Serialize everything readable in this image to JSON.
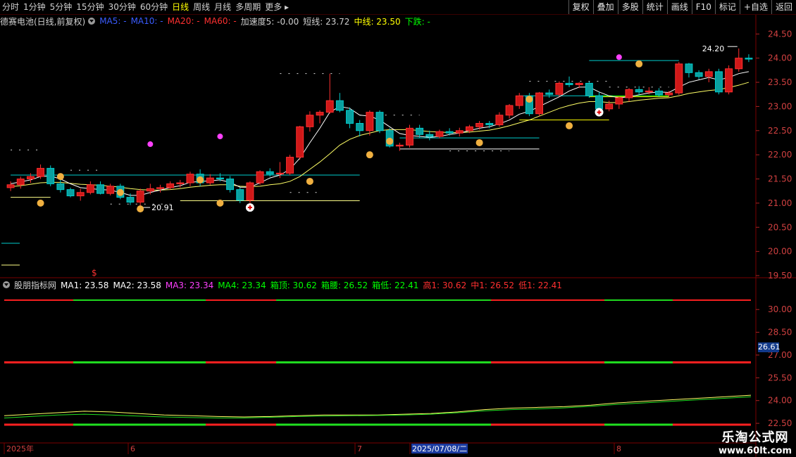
{
  "toolbar": {
    "periods": [
      "分时",
      "1分钟",
      "5分钟",
      "15分钟",
      "30分钟",
      "60分钟",
      "日线",
      "周线",
      "月线",
      "多周期",
      "更多"
    ],
    "active_period": "日线",
    "right_buttons": [
      "复权",
      "叠加",
      "多股",
      "统计",
      "画线",
      "F10",
      "标记",
      "+自选",
      "返回"
    ]
  },
  "main_legend": {
    "stock": "德赛电池(日线,前复权)",
    "ma5": "MA5: -",
    "ma10": "MA10: -",
    "ma20": "MA20: -",
    "ma60": "MA60: -",
    "accel": "加速度5: -0.00",
    "short": "短线: 23.72",
    "mid": "中线: 23.50",
    "down": "下跌: -",
    "colors": {
      "ma5": "#3a5cff",
      "ma10": "#3a5cff",
      "ma20": "#ff3030",
      "ma60": "#ff3030",
      "accel": "#d0d0d0",
      "short": "#d0d0d0",
      "mid": "#ffff00",
      "down": "#00ff00"
    }
  },
  "indicator_legend": {
    "name": "股朋指标网",
    "items": [
      {
        "text": "MA1: 23.58",
        "color": "#ffffff"
      },
      {
        "text": "MA2: 23.58",
        "color": "#ffffff"
      },
      {
        "text": "MA3: 23.34",
        "color": "#ff40ff"
      },
      {
        "text": "MA4: 23.34",
        "color": "#00ff00"
      },
      {
        "text": "箱顶: 30.62",
        "color": "#00ff00"
      },
      {
        "text": "箱腰: 26.52",
        "color": "#00ff00"
      },
      {
        "text": "箱低: 22.41",
        "color": "#00ff00"
      },
      {
        "text": "高1: 30.62",
        "color": "#ff3030"
      },
      {
        "text": "中1: 26.52",
        "color": "#ff3030"
      },
      {
        "text": "低1: 22.41",
        "color": "#ff3030"
      }
    ]
  },
  "main_axis": [
    "24.50",
    "24.00",
    "23.50",
    "23.00",
    "22.50",
    "22.00",
    "21.50",
    "21.00",
    "20.50",
    "20.00",
    "19.50"
  ],
  "ind_axis": [
    "30.00",
    "28.50",
    "27.00",
    "25.50",
    "24.00",
    "22.50"
  ],
  "indicator_current": "26.61",
  "date_axis": [
    {
      "label": "2025年",
      "highlight": false
    },
    {
      "label": "6",
      "highlight": false
    },
    {
      "label": "7",
      "highlight": false
    },
    {
      "label": "2025/07/08/二",
      "highlight": true
    },
    {
      "label": "8",
      "highlight": false
    }
  ],
  "annotations": {
    "high": "24.20",
    "low": "20.91"
  },
  "watermark": {
    "name": "乐淘公式网",
    "url": "www.60lt.com"
  },
  "colors": {
    "up": "#ff3030",
    "down": "#00cccc",
    "bg": "#000000",
    "grid": "#5a0000"
  },
  "chart_data": {
    "type": "candlestick",
    "ylim": [
      19.5,
      24.65
    ],
    "candles": [
      [
        21.32,
        21.45,
        21.25,
        21.38
      ],
      [
        21.38,
        21.55,
        21.3,
        21.5
      ],
      [
        21.5,
        21.62,
        21.42,
        21.55
      ],
      [
        21.55,
        21.8,
        21.5,
        21.72
      ],
      [
        21.72,
        21.78,
        21.35,
        21.4
      ],
      [
        21.4,
        21.5,
        21.22,
        21.28
      ],
      [
        21.28,
        21.32,
        21.12,
        21.15
      ],
      [
        21.15,
        21.3,
        21.05,
        21.22
      ],
      [
        21.22,
        21.45,
        21.18,
        21.38
      ],
      [
        21.38,
        21.45,
        21.18,
        21.2
      ],
      [
        21.2,
        21.4,
        21.16,
        21.35
      ],
      [
        21.35,
        21.4,
        21.08,
        21.12
      ],
      [
        21.12,
        21.2,
        20.96,
        21.02
      ],
      [
        21.02,
        21.3,
        20.91,
        21.25
      ],
      [
        21.25,
        21.4,
        21.18,
        21.3
      ],
      [
        21.3,
        21.38,
        21.22,
        21.32
      ],
      [
        21.32,
        21.45,
        21.28,
        21.4
      ],
      [
        21.4,
        21.48,
        21.32,
        21.42
      ],
      [
        21.42,
        21.65,
        21.35,
        21.6
      ],
      [
        21.6,
        21.7,
        21.35,
        21.42
      ],
      [
        21.42,
        21.6,
        21.38,
        21.52
      ],
      [
        21.52,
        21.62,
        21.45,
        21.5
      ],
      [
        21.5,
        21.56,
        21.22,
        21.28
      ],
      [
        21.28,
        21.32,
        21.0,
        21.06
      ],
      [
        21.06,
        21.45,
        21.0,
        21.42
      ],
      [
        21.42,
        21.68,
        21.38,
        21.65
      ],
      [
        21.65,
        21.72,
        21.55,
        21.6
      ],
      [
        21.6,
        21.85,
        21.52,
        21.62
      ],
      [
        21.62,
        22.0,
        21.58,
        21.95
      ],
      [
        21.95,
        22.6,
        21.9,
        22.58
      ],
      [
        22.58,
        22.9,
        22.48,
        22.82
      ],
      [
        22.82,
        22.92,
        22.65,
        22.88
      ],
      [
        22.88,
        23.68,
        22.85,
        23.12
      ],
      [
        23.12,
        23.28,
        22.88,
        22.92
      ],
      [
        22.92,
        22.98,
        22.55,
        22.65
      ],
      [
        22.65,
        22.72,
        22.38,
        22.5
      ],
      [
        22.5,
        22.92,
        22.4,
        22.88
      ],
      [
        22.88,
        22.92,
        22.45,
        22.5
      ],
      [
        22.5,
        22.55,
        22.15,
        22.18
      ],
      [
        22.18,
        22.25,
        22.08,
        22.2
      ],
      [
        22.2,
        22.62,
        22.15,
        22.55
      ],
      [
        22.55,
        22.62,
        22.35,
        22.42
      ],
      [
        22.42,
        22.5,
        22.3,
        22.38
      ],
      [
        22.38,
        22.52,
        22.34,
        22.48
      ],
      [
        22.48,
        22.55,
        22.4,
        22.45
      ],
      [
        22.45,
        22.56,
        22.38,
        22.5
      ],
      [
        22.5,
        22.62,
        22.45,
        22.58
      ],
      [
        22.58,
        22.7,
        22.52,
        22.65
      ],
      [
        22.65,
        22.7,
        22.55,
        22.62
      ],
      [
        22.62,
        22.88,
        22.58,
        22.82
      ],
      [
        22.82,
        23.05,
        22.75,
        23.02
      ],
      [
        23.02,
        23.28,
        22.95,
        23.22
      ],
      [
        23.22,
        23.28,
        22.8,
        22.85
      ],
      [
        22.85,
        23.3,
        22.8,
        23.28
      ],
      [
        23.28,
        23.35,
        23.18,
        23.25
      ],
      [
        23.25,
        23.52,
        23.2,
        23.48
      ],
      [
        23.48,
        23.62,
        23.4,
        23.45
      ],
      [
        23.45,
        23.5,
        23.38,
        23.48
      ],
      [
        23.48,
        23.52,
        23.18,
        23.22
      ],
      [
        23.22,
        23.3,
        22.92,
        22.95
      ],
      [
        22.95,
        23.12,
        22.9,
        23.05
      ],
      [
        23.05,
        23.2,
        22.95,
        23.18
      ],
      [
        23.18,
        23.38,
        23.1,
        23.35
      ],
      [
        23.35,
        23.42,
        23.24,
        23.3
      ],
      [
        23.3,
        23.4,
        23.25,
        23.32
      ],
      [
        23.32,
        23.38,
        23.2,
        23.24
      ],
      [
        23.24,
        23.32,
        23.2,
        23.28
      ],
      [
        23.28,
        23.92,
        23.24,
        23.88
      ],
      [
        23.88,
        23.9,
        23.6,
        23.7
      ],
      [
        23.7,
        23.75,
        23.56,
        23.62
      ],
      [
        23.62,
        23.78,
        23.5,
        23.72
      ],
      [
        23.72,
        23.78,
        23.25,
        23.3
      ],
      [
        23.3,
        23.85,
        23.25,
        23.78
      ],
      [
        23.78,
        24.2,
        23.72,
        24.0
      ],
      [
        24.0,
        24.08,
        23.92,
        23.98
      ]
    ],
    "mid_line": [
      21.34,
      21.36,
      21.39,
      21.42,
      21.43,
      21.43,
      21.41,
      21.39,
      21.38,
      21.37,
      21.35,
      21.33,
      21.3,
      21.28,
      21.27,
      21.27,
      21.28,
      21.3,
      21.33,
      21.35,
      21.37,
      21.38,
      21.38,
      21.35,
      21.34,
      21.35,
      21.38,
      21.4,
      21.45,
      21.55,
      21.7,
      21.85,
      22.02,
      22.2,
      22.32,
      22.4,
      22.45,
      22.5,
      22.52,
      22.52,
      22.52,
      22.5,
      22.48,
      22.47,
      22.46,
      22.46,
      22.47,
      22.49,
      22.51,
      22.55,
      22.6,
      22.66,
      22.72,
      22.8,
      22.88,
      22.96,
      23.02,
      23.07,
      23.1,
      23.1,
      23.08,
      23.08,
      23.1,
      23.13,
      23.15,
      23.17,
      23.18,
      23.22,
      23.27,
      23.3,
      23.33,
      23.35,
      23.39,
      23.44,
      23.5
    ],
    "short_line": [
      21.4,
      21.44,
      21.48,
      21.55,
      21.56,
      21.5,
      21.4,
      21.32,
      21.3,
      21.28,
      21.27,
      21.22,
      21.16,
      21.16,
      21.22,
      21.27,
      21.32,
      21.36,
      21.43,
      21.45,
      21.46,
      21.48,
      21.43,
      21.33,
      21.33,
      21.42,
      21.52,
      21.58,
      21.7,
      21.93,
      22.25,
      22.55,
      22.88,
      23.0,
      22.96,
      22.82,
      22.8,
      22.72,
      22.58,
      22.44,
      22.4,
      22.38,
      22.36,
      22.38,
      22.42,
      22.45,
      22.5,
      22.55,
      22.58,
      22.64,
      22.72,
      22.84,
      22.9,
      23.0,
      23.1,
      23.2,
      23.32,
      23.4,
      23.4,
      23.3,
      23.22,
      23.18,
      23.2,
      23.24,
      23.28,
      23.3,
      23.29,
      23.4,
      23.5,
      23.55,
      23.6,
      23.55,
      23.6,
      23.68,
      23.72
    ],
    "box_lines": [
      {
        "x0": 0,
        "x1": 35,
        "y": 21.58,
        "color": "#00cccc"
      },
      {
        "x0": 17,
        "x1": 35,
        "y": 21.05,
        "color": "#ffff88"
      },
      {
        "x0": 0,
        "x1": 4,
        "y": 21.12,
        "color": "#ffff88"
      },
      {
        "x0": 39,
        "x1": 53,
        "y": 22.35,
        "color": "#00cccc"
      },
      {
        "x0": 39,
        "x1": 53,
        "y": 22.12,
        "color": "#ffffff"
      },
      {
        "x0": 51,
        "x1": 60,
        "y": 23.22,
        "color": "#00cccc"
      },
      {
        "x0": 51,
        "x1": 60,
        "y": 22.72,
        "color": "#ffff00"
      },
      {
        "x0": 58,
        "x1": 66,
        "y": 23.2,
        "color": "#ffff00"
      },
      {
        "x0": 58,
        "x1": 66,
        "y": 23.22,
        "color": "#00ff00"
      },
      {
        "x0": 58,
        "x1": 67,
        "y": 23.95,
        "color": "#00cccc"
      }
    ],
    "ind_series": {
      "a": [
        23.0,
        23.1,
        23.2,
        23.3,
        23.25,
        23.15,
        23.05,
        23.0,
        22.95,
        22.92,
        22.95,
        23.0,
        23.05,
        23.05,
        23.05,
        23.1,
        23.15,
        23.25,
        23.4,
        23.5,
        23.55,
        23.6,
        23.7,
        23.85,
        23.95,
        24.05,
        24.15,
        24.25,
        24.35
      ],
      "b": [
        22.85,
        22.95,
        23.05,
        23.1,
        23.05,
        22.98,
        22.92,
        22.88,
        22.85,
        22.85,
        22.9,
        22.95,
        22.98,
        23.0,
        23.02,
        23.05,
        23.1,
        23.2,
        23.32,
        23.4,
        23.45,
        23.52,
        23.62,
        23.75,
        23.85,
        23.95,
        24.05,
        24.15,
        24.25
      ]
    },
    "ind_levels": [
      30.62,
      26.52,
      22.41
    ],
    "ind_ylim": [
      21.3,
      31.4
    ]
  }
}
